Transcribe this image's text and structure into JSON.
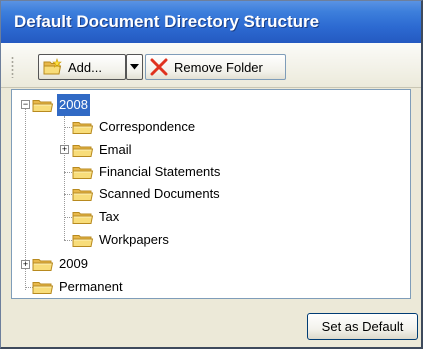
{
  "window": {
    "title": "Default Document Directory Structure"
  },
  "toolbar": {
    "add_label": "Add...",
    "remove_label": "Remove Folder"
  },
  "tree": {
    "nodes": [
      {
        "label": "2008",
        "selected": true,
        "expanded": true
      },
      {
        "label": "Correspondence"
      },
      {
        "label": "Email",
        "collapsed": true
      },
      {
        "label": "Financial Statements"
      },
      {
        "label": "Scanned Documents"
      },
      {
        "label": "Tax"
      },
      {
        "label": "Workpapers"
      },
      {
        "label": "2009",
        "collapsed": true
      },
      {
        "label": "Permanent"
      }
    ]
  },
  "footer": {
    "set_default_label": "Set as Default"
  },
  "colors": {
    "titlebar": "#2d6bd2",
    "selection": "#316ac5",
    "folder_fill": "#f6d66e",
    "remove_icon": "#e0321f"
  },
  "icons": {
    "folder": "folder-icon",
    "add": "new-folder-icon",
    "remove": "red-x-icon",
    "dropdown": "chevron-down-icon"
  }
}
